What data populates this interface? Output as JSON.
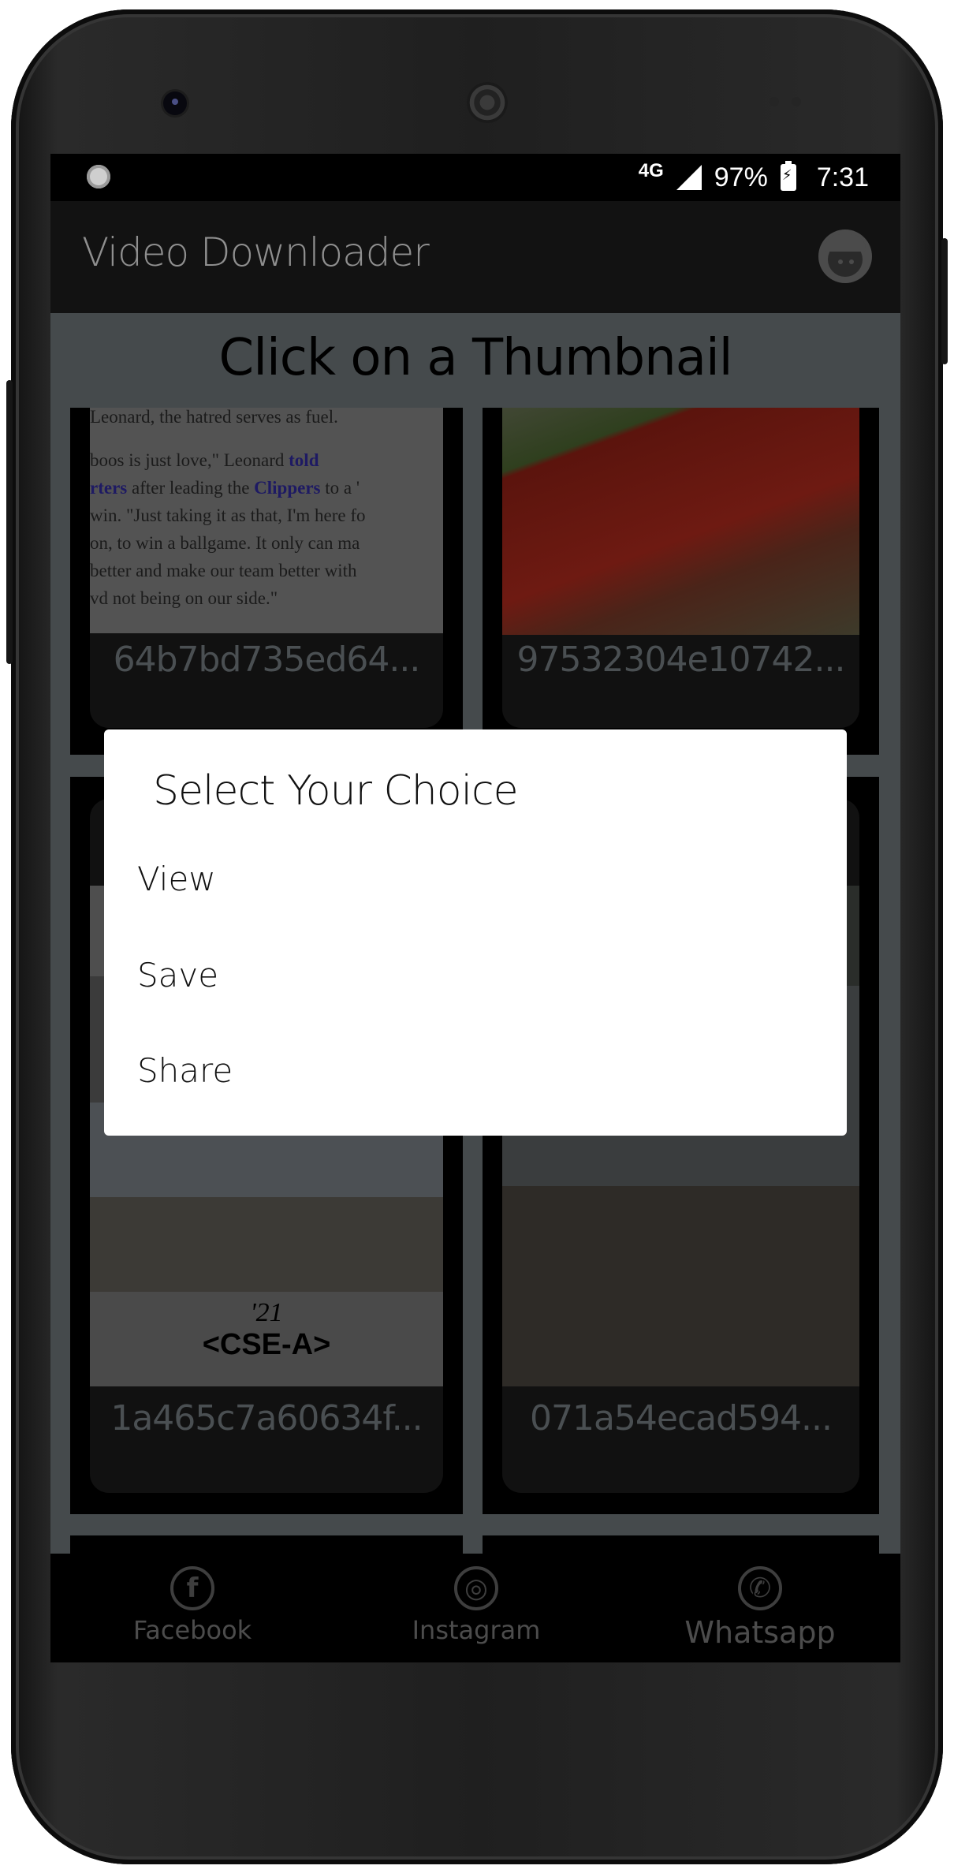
{
  "status_bar": {
    "network": "4G",
    "battery": "97%",
    "time": "7:31"
  },
  "app_bar": {
    "title": "Video Downloader",
    "profile_icon": "kid-face-icon"
  },
  "content": {
    "heading": "Click on a Thumbnail",
    "cards": [
      {
        "caption": "64b7bd735ed64...",
        "thumbnail": "article-text",
        "article_lines": [
          {
            "parts": [
              {
                "t": "Leonard, the hatred serves as fuel.",
                "link": false
              }
            ]
          },
          {
            "parts": [
              {
                "t": " boos is just love,\" Leonard ",
                "link": false
              },
              {
                "t": "told",
                "link": true
              }
            ]
          },
          {
            "parts": [
              {
                "t": "rters",
                "link": true
              },
              {
                "t": " after leading the ",
                "link": false
              },
              {
                "t": "Clippers",
                "link": true
              },
              {
                "t": " to a '",
                "link": false
              }
            ]
          },
          {
            "parts": [
              {
                "t": "win. \"Just taking it as that, I'm here fo",
                "link": false
              }
            ]
          },
          {
            "parts": [
              {
                "t": "on, to win a ballgame. It only can ma",
                "link": false
              }
            ]
          },
          {
            "parts": [
              {
                "t": "better and make our team better with",
                "link": false
              }
            ]
          },
          {
            "parts": [
              {
                "t": "vd not being on our side.\"",
                "link": false
              }
            ]
          }
        ]
      },
      {
        "caption": "97532304e10742...",
        "thumbnail": "red-fabric-photo"
      },
      {
        "caption": "1a465c7a60634f...",
        "thumbnail": "group-photo",
        "badge_year": "'21",
        "badge_text": "<CSE-A>"
      },
      {
        "caption": "071a54ecad594...",
        "thumbnail": "group-photo-2"
      }
    ]
  },
  "bottom_nav": [
    {
      "label": "Facebook",
      "icon": "facebook-icon",
      "glyph": "f"
    },
    {
      "label": "Instagram",
      "icon": "instagram-icon",
      "glyph": "◎"
    },
    {
      "label": "Whatsapp",
      "icon": "whatsapp-icon",
      "glyph": "✆"
    }
  ],
  "dialog": {
    "title": "Select Your Choice",
    "options": [
      "View",
      "Save",
      "Share"
    ]
  }
}
